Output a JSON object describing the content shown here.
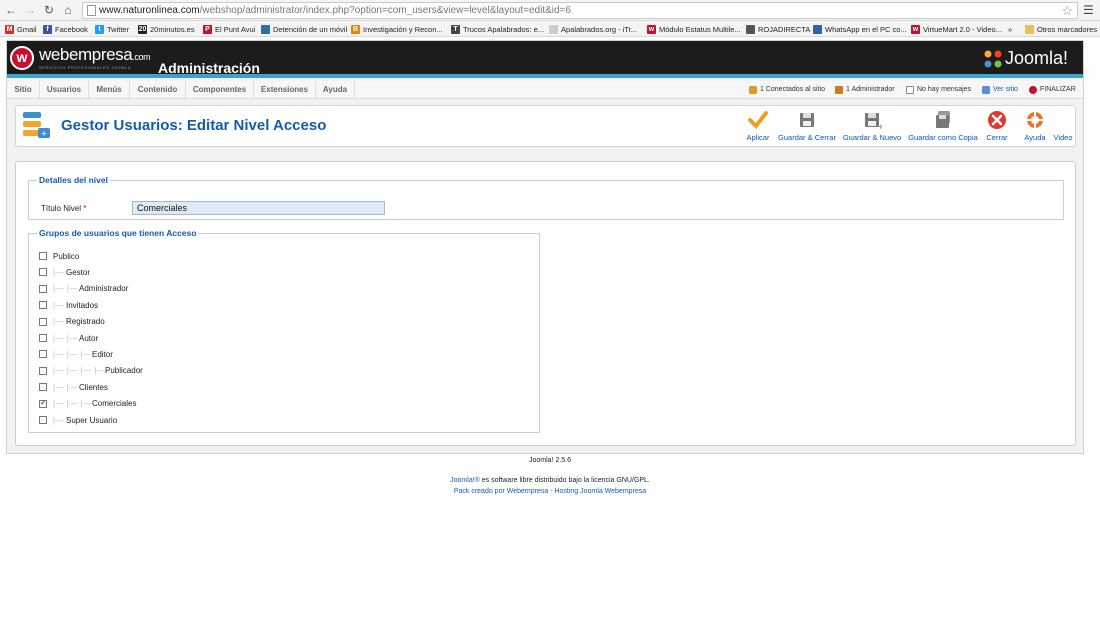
{
  "browser": {
    "url_host": "www.naturonlinea.com",
    "url_path": "/webshop/administrator/index.php?option=com_users&view=level&layout=edit&id=6",
    "bookmarks": [
      {
        "label": "Gmail",
        "color": "#d93025",
        "glyph": "M"
      },
      {
        "label": "Facebook",
        "color": "#3b5998",
        "glyph": "f"
      },
      {
        "label": "Twitter",
        "color": "#1da1f2",
        "glyph": "t"
      },
      {
        "label": "20minutos.es",
        "color": "#222222",
        "glyph": "20"
      },
      {
        "label": "El Punt Avui",
        "color": "#c8102e",
        "glyph": "P"
      },
      {
        "label": "Detención de un móvil",
        "color": "#2f6f9f",
        "glyph": ""
      },
      {
        "label": "Investigación y Recon...",
        "color": "#f57c00",
        "glyph": "B"
      },
      {
        "label": "Trucos Apalabrados: e...",
        "color": "#444444",
        "glyph": "T"
      },
      {
        "label": "Apalabrados.org - iTr...",
        "color": "#cccccc",
        "glyph": ""
      },
      {
        "label": "Módulo Estatus Multile...",
        "color": "#c8102e",
        "glyph": "w"
      },
      {
        "label": "ROJADIRECTA",
        "color": "#555555",
        "glyph": ""
      },
      {
        "label": "WhatsApp en el PC co...",
        "color": "#3a5bb5",
        "glyph": ""
      },
      {
        "label": "VirtueMart 2.0 - Video...",
        "color": "#c8102e",
        "glyph": "w"
      }
    ],
    "bookmarks_more": "»",
    "other_bookmarks": "Otros marcadores"
  },
  "header": {
    "brand_name": "webempresa",
    "brand_suffix": ".com",
    "brand_tagline": "SERVICIOS PROFESIONALES JOOMLA",
    "brand_letter": "w",
    "admin_title": "Administración",
    "joomla_logo": "Joomla!",
    "colors": {
      "header_bg": "#1c1c1c",
      "accent_stripe": "#3ba2d0",
      "brand_red": "#c8102e"
    }
  },
  "menu": {
    "items": [
      "Sitio",
      "Usuarios",
      "Menús",
      "Contenido",
      "Componentes",
      "Extensiones",
      "Ayuda"
    ],
    "status": {
      "connected": "1 Conectados al sitio",
      "admins": "1 Administrador",
      "messages": "No hay mensajes",
      "view_site": "Ver sitio",
      "logout": "FINALIZAR"
    }
  },
  "toolbar": {
    "title": "Gestor Usuarios: Editar Nivel Acceso",
    "buttons": {
      "apply": "Aplicar",
      "save_close": "Guardar & Cerrar",
      "save_new": "Guardar & Nuevo",
      "save_copy": "Guardar como Copia",
      "close": "Cerrar",
      "help": "Ayuda",
      "video": "Video"
    }
  },
  "form": {
    "details_legend": "Detalles del nivel",
    "level_title_label": "Título Nivel",
    "required_marker": "*",
    "level_title_value": "Comerciales",
    "groups_legend": "Grupos de usuarios que tienen Acceso",
    "groups": [
      {
        "name": "Publico",
        "depth": 0,
        "checked": false
      },
      {
        "name": "Gestor",
        "depth": 1,
        "checked": false
      },
      {
        "name": "Administrador",
        "depth": 2,
        "checked": false
      },
      {
        "name": "Invitados",
        "depth": 1,
        "checked": false
      },
      {
        "name": "Registrado",
        "depth": 1,
        "checked": false
      },
      {
        "name": "Autor",
        "depth": 2,
        "checked": false
      },
      {
        "name": "Editor",
        "depth": 3,
        "checked": false
      },
      {
        "name": "Publicador",
        "depth": 4,
        "checked": false
      },
      {
        "name": "Clientes",
        "depth": 2,
        "checked": false
      },
      {
        "name": "Comerciales",
        "depth": 3,
        "checked": true
      },
      {
        "name": "Super Usuario",
        "depth": 1,
        "checked": false
      }
    ]
  },
  "footer": {
    "version": "Joomla! 2.5.6",
    "license_link": "Joomla!®",
    "license_text": " es software libre distribuido bajo la licencia GNU/GPL.",
    "credit_text": "Pack creado por Webempresa - Hosting Joomla Webempresa"
  }
}
